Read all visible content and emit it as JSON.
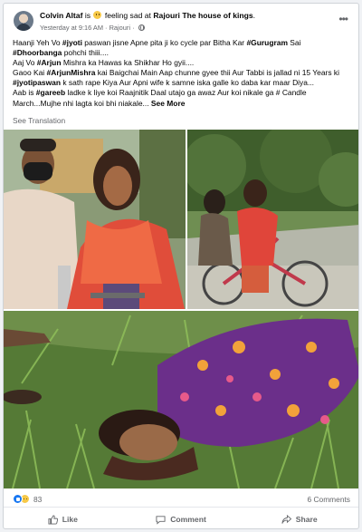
{
  "post": {
    "author": "Colvin Altaf",
    "is_word": "is",
    "feeling": "feeling sad at",
    "location": "Rajouri The house of kings",
    "location_suffix": ".",
    "timestamp": "Yesterday at 9:16 AM",
    "separator": "·",
    "place": "Rajouri",
    "separator2": "·",
    "more_icon": "more-horizontal-icon",
    "text": {
      "l1_a": "Haanji Yeh Vo ",
      "l1_b": "#jyoti",
      "l1_c": " paswan jisne Apne pita ji ko cycle par Bitha Kar ",
      "l1_d": "#Gurugram",
      "l1_e": " Sai",
      "l2_a": "#Dhoorbanga",
      "l2_b": " pohchi  thiii....",
      "l3_a": "Aaj Vo ",
      "l3_b": "#Arjun",
      "l3_c": " Mishra ka Hawas ka Shikhar Ho gyii....",
      "l4_a": "Gaoo Kai ",
      "l4_b": "#ArjunMishra",
      "l4_c": " kai Baigchai Main Aap chunne gyee thii Aur Tabbi is jallad ni 15 Years ki",
      "l5_a": "#jyotipaswan",
      "l5_b": " k sath rape Kiya Aur Apni wife k samne iska galle ko daba kar maar Diya...",
      "l6_a": "Aab is ",
      "l6_b": "#gareeb",
      "l6_c": " ladke k liye koi Raajnitik Daal utajo ga awaz Aur koi nikale ga # Candle",
      "l7_a": "March...Mujhe nhi lagta koi bhi niakale... ",
      "see_more": "See More"
    },
    "see_translation": "See Translation"
  },
  "stats": {
    "reaction_icons": [
      "like-icon",
      "sad-icon"
    ],
    "reaction_count": "83",
    "comments": "6 Comments"
  },
  "actions": {
    "like": "Like",
    "comment": "Comment",
    "share": "Share"
  },
  "colors": {
    "like_blue": "#1877f2",
    "secondary_text": "#65676b",
    "sad_yellow": "#f7c948"
  }
}
